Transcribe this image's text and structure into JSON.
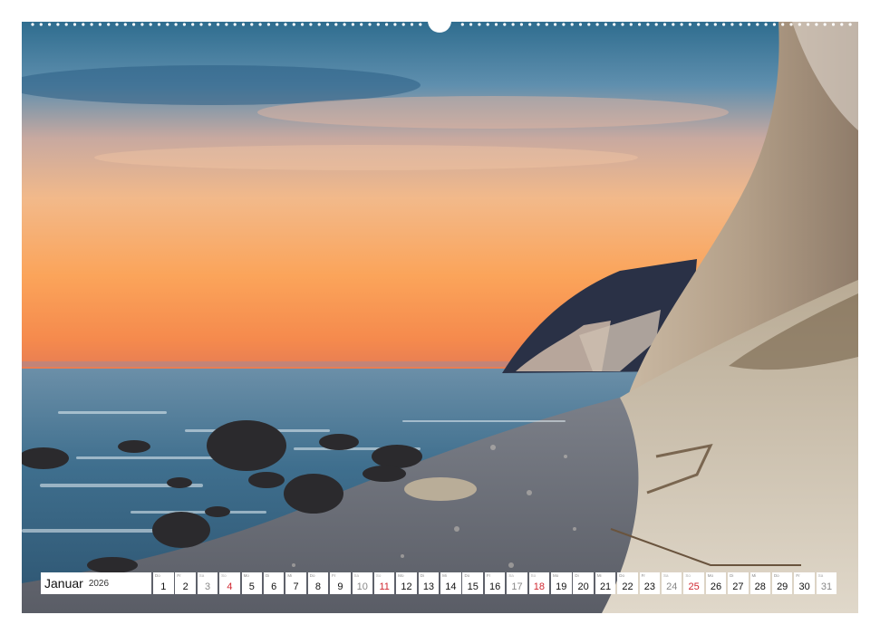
{
  "calendar": {
    "month": "Januar",
    "year": "2026",
    "days": [
      {
        "wd": "Do",
        "num": "1",
        "kind": "weekday"
      },
      {
        "wd": "Fr",
        "num": "2",
        "kind": "weekday"
      },
      {
        "wd": "Sa",
        "num": "3",
        "kind": "sat"
      },
      {
        "wd": "So",
        "num": "4",
        "kind": "sun"
      },
      {
        "wd": "Mo",
        "num": "5",
        "kind": "weekday"
      },
      {
        "wd": "Di",
        "num": "6",
        "kind": "weekday"
      },
      {
        "wd": "Mi",
        "num": "7",
        "kind": "weekday"
      },
      {
        "wd": "Do",
        "num": "8",
        "kind": "weekday"
      },
      {
        "wd": "Fr",
        "num": "9",
        "kind": "weekday"
      },
      {
        "wd": "Sa",
        "num": "10",
        "kind": "sat"
      },
      {
        "wd": "So",
        "num": "11",
        "kind": "sun"
      },
      {
        "wd": "Mo",
        "num": "12",
        "kind": "weekday"
      },
      {
        "wd": "Di",
        "num": "13",
        "kind": "weekday"
      },
      {
        "wd": "Mi",
        "num": "14",
        "kind": "weekday"
      },
      {
        "wd": "Do",
        "num": "15",
        "kind": "weekday"
      },
      {
        "wd": "Fr",
        "num": "16",
        "kind": "weekday"
      },
      {
        "wd": "Sa",
        "num": "17",
        "kind": "sat"
      },
      {
        "wd": "So",
        "num": "18",
        "kind": "sun"
      },
      {
        "wd": "Mo",
        "num": "19",
        "kind": "weekday"
      },
      {
        "wd": "Di",
        "num": "20",
        "kind": "weekday"
      },
      {
        "wd": "Mi",
        "num": "21",
        "kind": "weekday"
      },
      {
        "wd": "Do",
        "num": "22",
        "kind": "weekday"
      },
      {
        "wd": "Fr",
        "num": "23",
        "kind": "weekday"
      },
      {
        "wd": "Sa",
        "num": "24",
        "kind": "sat"
      },
      {
        "wd": "So",
        "num": "25",
        "kind": "sun"
      },
      {
        "wd": "Mo",
        "num": "26",
        "kind": "weekday"
      },
      {
        "wd": "Di",
        "num": "27",
        "kind": "weekday"
      },
      {
        "wd": "Mi",
        "num": "28",
        "kind": "weekday"
      },
      {
        "wd": "Do",
        "num": "29",
        "kind": "weekday"
      },
      {
        "wd": "Fr",
        "num": "30",
        "kind": "weekday"
      },
      {
        "wd": "Sa",
        "num": "31",
        "kind": "sat"
      }
    ]
  },
  "colors": {
    "sunday": "#d0262f",
    "saturday": "#888888",
    "weekday": "#111111"
  }
}
